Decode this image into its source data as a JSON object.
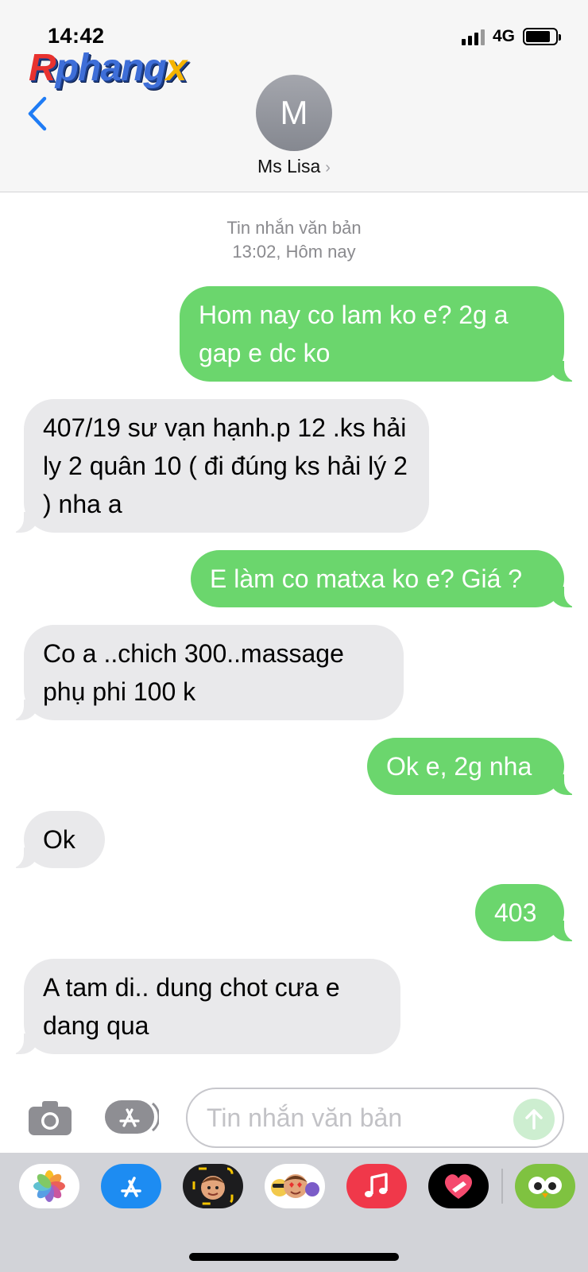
{
  "status_bar": {
    "time": "14:42",
    "network": "4G",
    "battery_level": 0.82
  },
  "watermark": {
    "part_a": "R",
    "part_b": "phang",
    "part_c": "x"
  },
  "header": {
    "avatar_initial": "M",
    "contact_name": "Ms Lisa",
    "contact_chevron": "›"
  },
  "thread": {
    "type_label": "Tin nhắn văn bản",
    "timestamp": "13:02, Hôm nay",
    "messages": [
      {
        "direction": "outgoing",
        "text": "Hom nay co lam ko e? 2g a gap e dc ko"
      },
      {
        "direction": "incoming",
        "text": "407/19 sư vạn hạnh.p 12 .ks hải ly 2  quân 10 ( đi đúng ks hải lý 2 ) nha a"
      },
      {
        "direction": "outgoing",
        "text": "E làm co matxa ko e? Giá ?"
      },
      {
        "direction": "incoming",
        "text": "Co a ..chich 300..massage phụ phi 100 k"
      },
      {
        "direction": "outgoing",
        "text": "Ok e, 2g nha"
      },
      {
        "direction": "incoming",
        "text": "Ok"
      },
      {
        "direction": "outgoing",
        "text": "403"
      },
      {
        "direction": "incoming",
        "text": "A tam di.. dung chot cưa e dang qua"
      }
    ]
  },
  "composer": {
    "placeholder": "Tin nhắn văn bản"
  },
  "app_drawer": {
    "apps": [
      "photos-icon",
      "app-store-icon",
      "memoji-icon",
      "animoji-stickers-icon",
      "music-icon",
      "digital-touch-icon",
      "duolingo-icon"
    ]
  },
  "colors": {
    "outgoing_bubble": "#6bd66d",
    "incoming_bubble": "#e9e9eb",
    "accent": "#1f7cf5"
  }
}
